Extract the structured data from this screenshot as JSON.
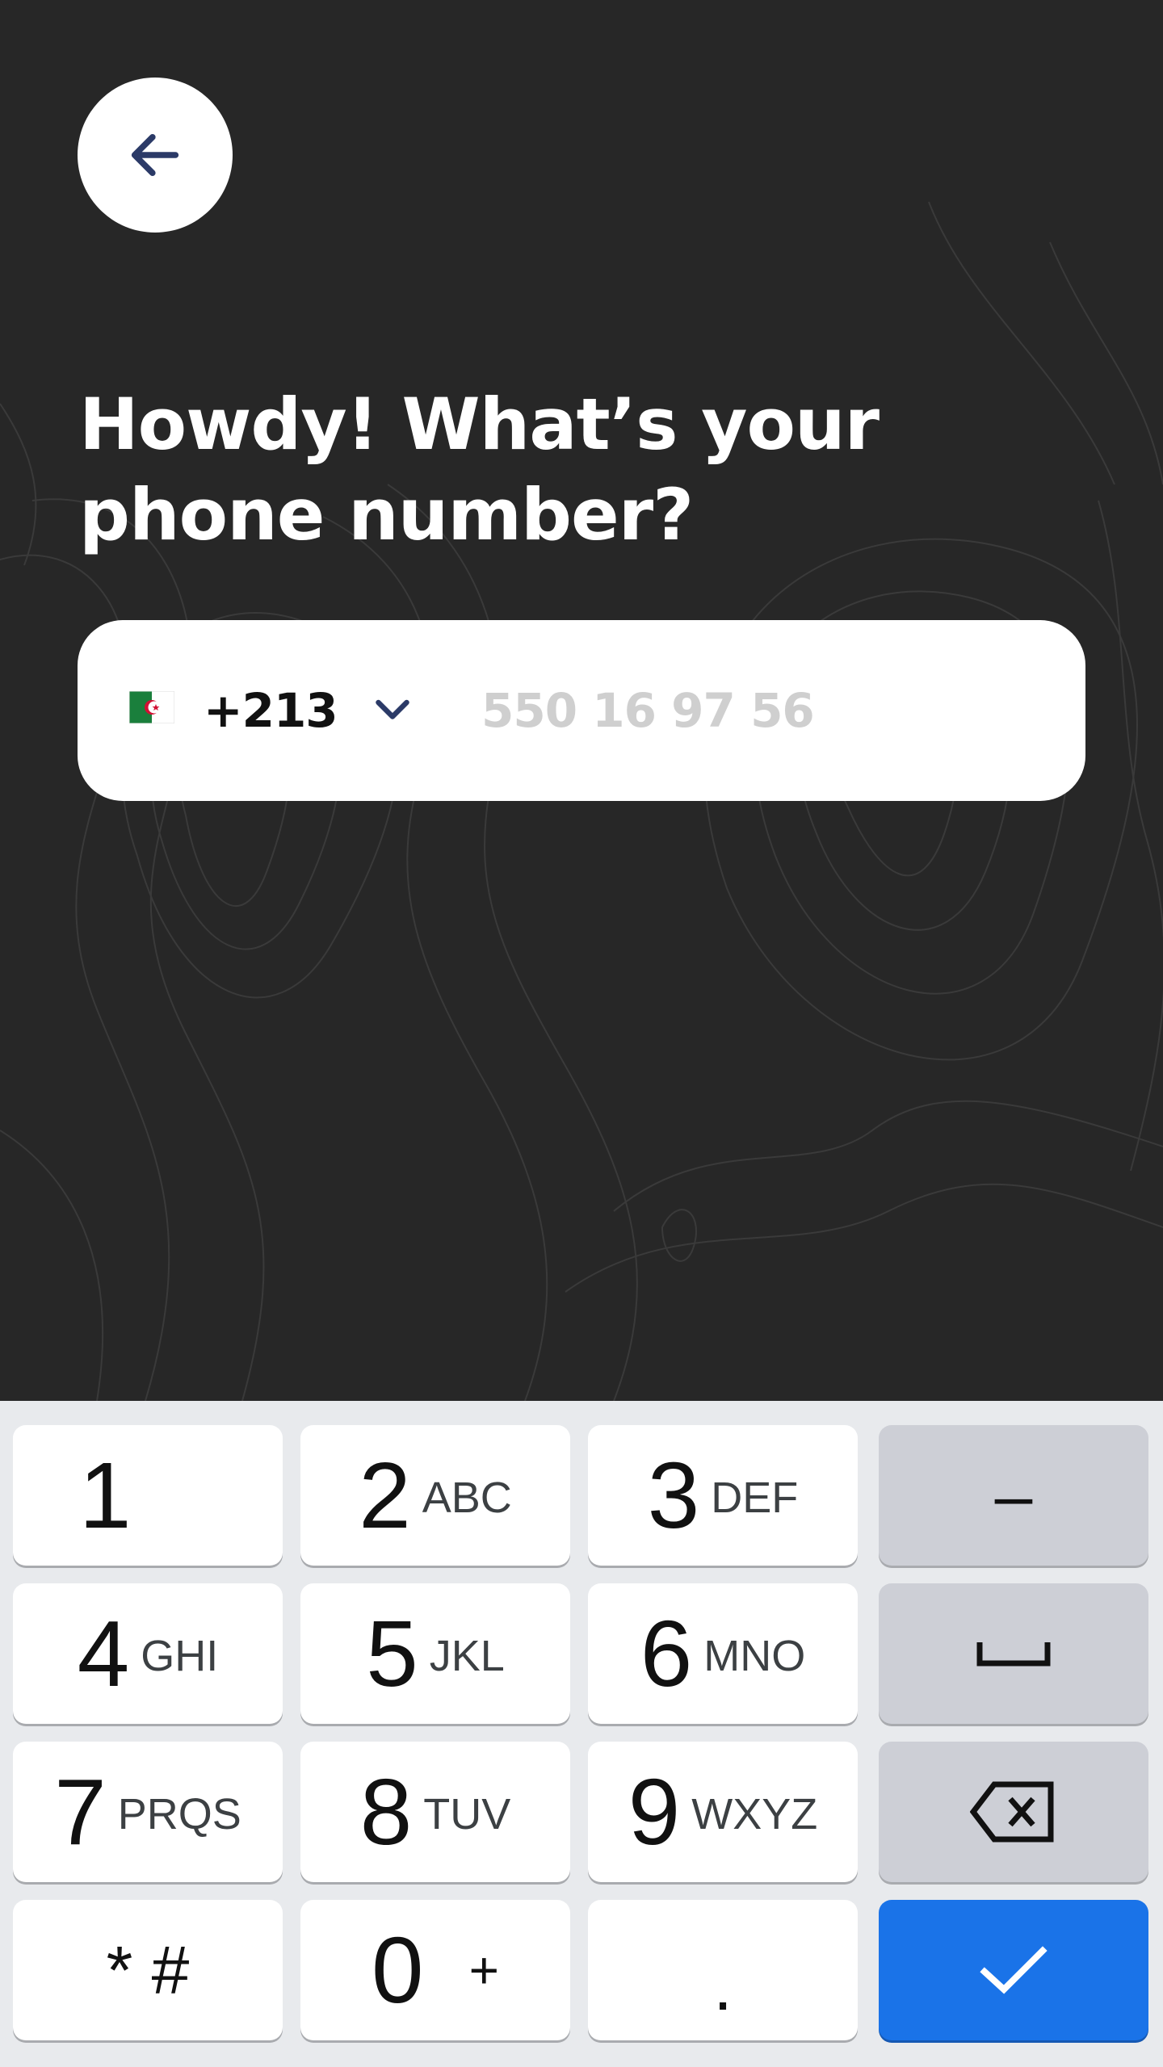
{
  "header": {
    "back_icon": "arrow-left-icon",
    "title_line1": "Howdy! What’s your",
    "title_line2": "phone number?"
  },
  "phone": {
    "flag_icon": "algeria-flag-icon",
    "country_code": "+213",
    "dropdown_icon": "chevron-down-icon",
    "placeholder": "550 16 97 56",
    "value": ""
  },
  "keyboard": {
    "keys": [
      {
        "digit": "1",
        "letters": ""
      },
      {
        "digit": "2",
        "letters": "ABC"
      },
      {
        "digit": "3",
        "letters": "DEF"
      },
      {
        "digit": "4",
        "letters": "GHI"
      },
      {
        "digit": "5",
        "letters": "JKL"
      },
      {
        "digit": "6",
        "letters": "MNO"
      },
      {
        "digit": "7",
        "letters": "PRQS"
      },
      {
        "digit": "8",
        "letters": "TUV"
      },
      {
        "digit": "9",
        "letters": "WXYZ"
      },
      {
        "digit": "0",
        "letters": "+"
      }
    ],
    "dash_label": "–",
    "star_hash_label": "* #",
    "dot_label": ".",
    "space_icon": "space-bar-icon",
    "backspace_icon": "backspace-icon",
    "done_icon": "checkmark-icon"
  },
  "colors": {
    "background": "#272727",
    "card": "#ffffff",
    "placeholder": "#cfcfcf",
    "keyboard_bg": "#e8eaed",
    "key_gray": "#cdcfd6",
    "accent_blue": "#1a73e8",
    "icon_navy": "#2b3a67"
  }
}
